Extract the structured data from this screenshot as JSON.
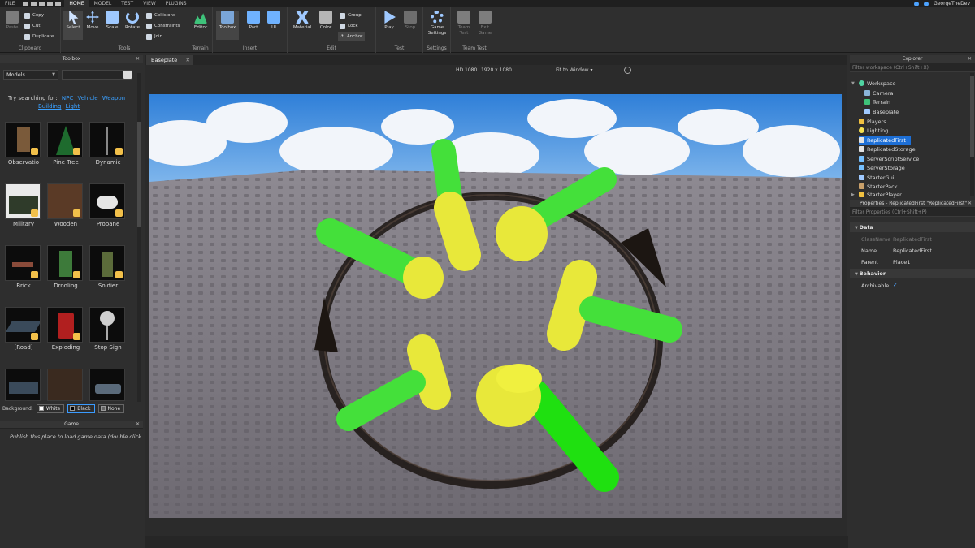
{
  "menubar": {
    "file": "FILE",
    "tabs": [
      "HOME",
      "MODEL",
      "TEST",
      "VIEW",
      "PLUGINS"
    ],
    "user": "GeorgeTheDev"
  },
  "ribbon": {
    "clipboard": {
      "paste": "Paste",
      "copy": "Copy",
      "cut": "Cut",
      "duplicate": "Duplicate",
      "label": "Clipboard"
    },
    "tools": {
      "select": "Select",
      "move": "Move",
      "scale": "Scale",
      "rotate": "Rotate",
      "collisions": "Collisions",
      "constraints": "Constraints",
      "join": "Join",
      "label": "Tools"
    },
    "terrain": {
      "editor": "Editor",
      "label": "Terrain"
    },
    "insert": {
      "toolbox": "Toolbox",
      "part": "Part",
      "ui": "UI",
      "label": "Insert"
    },
    "edit": {
      "material": "Material",
      "color": "Color",
      "group": "Group",
      "lock": "Lock",
      "anchor": "Anchor",
      "label": "Edit"
    },
    "test": {
      "play": "Play",
      "stop": "Stop",
      "label": "Test"
    },
    "settings": {
      "game_settings": "Game Settings",
      "label": "Settings"
    },
    "team_test": {
      "team_test": "Team Test",
      "exit_game": "Exit Game",
      "label": "Team Test"
    }
  },
  "toolbox": {
    "title": "Toolbox",
    "category": "Models",
    "suggest_prefix": "Try searching for:",
    "suggestions": [
      "NPC",
      "Vehicle",
      "Weapon",
      "Building",
      "Light"
    ],
    "items": [
      "Observatio",
      "Pine Tree",
      "Dynamic",
      "Military",
      "Wooden",
      "Propane",
      "Brick",
      "Drooling",
      "Soldier",
      "[Road]",
      "Exploding",
      "Stop Sign"
    ],
    "background_label": "Background:",
    "backgrounds": [
      "White",
      "Black",
      "None"
    ]
  },
  "game": {
    "title": "Game",
    "message": "Publish this place to load game data (double click h..."
  },
  "viewport": {
    "tab": "Baseplate",
    "resolution": "HD 1080",
    "dims": "1920 x 1080",
    "fit": "Fit to Window"
  },
  "explorer": {
    "title": "Explorer",
    "filter_placeholder": "Filter workspace (Ctrl+Shift+X)",
    "items": [
      "Workspace",
      "Camera",
      "Terrain",
      "Baseplate",
      "Players",
      "Lighting",
      "ReplicatedFirst",
      "ReplicatedStorage",
      "ServerScriptService",
      "ServerStorage",
      "StarterGui",
      "StarterPack",
      "StarterPlayer"
    ]
  },
  "properties": {
    "title": "Properties - ReplicatedFirst \"ReplicatedFirst\"",
    "filter_placeholder": "Filter Properties (Ctrl+Shift+P)",
    "cat_data": "Data",
    "classname_key": "ClassName",
    "classname_val": "ReplicatedFirst",
    "name_key": "Name",
    "name_val": "ReplicatedFirst",
    "parent_key": "Parent",
    "parent_val": "Place1",
    "cat_behavior": "Behavior",
    "archivable_key": "Archivable",
    "archivable_val": true
  },
  "colors": {
    "accent": "#1d6fd6",
    "link": "#3aa0ff",
    "green": "#44e03a",
    "yellow": "#e8e83a"
  }
}
